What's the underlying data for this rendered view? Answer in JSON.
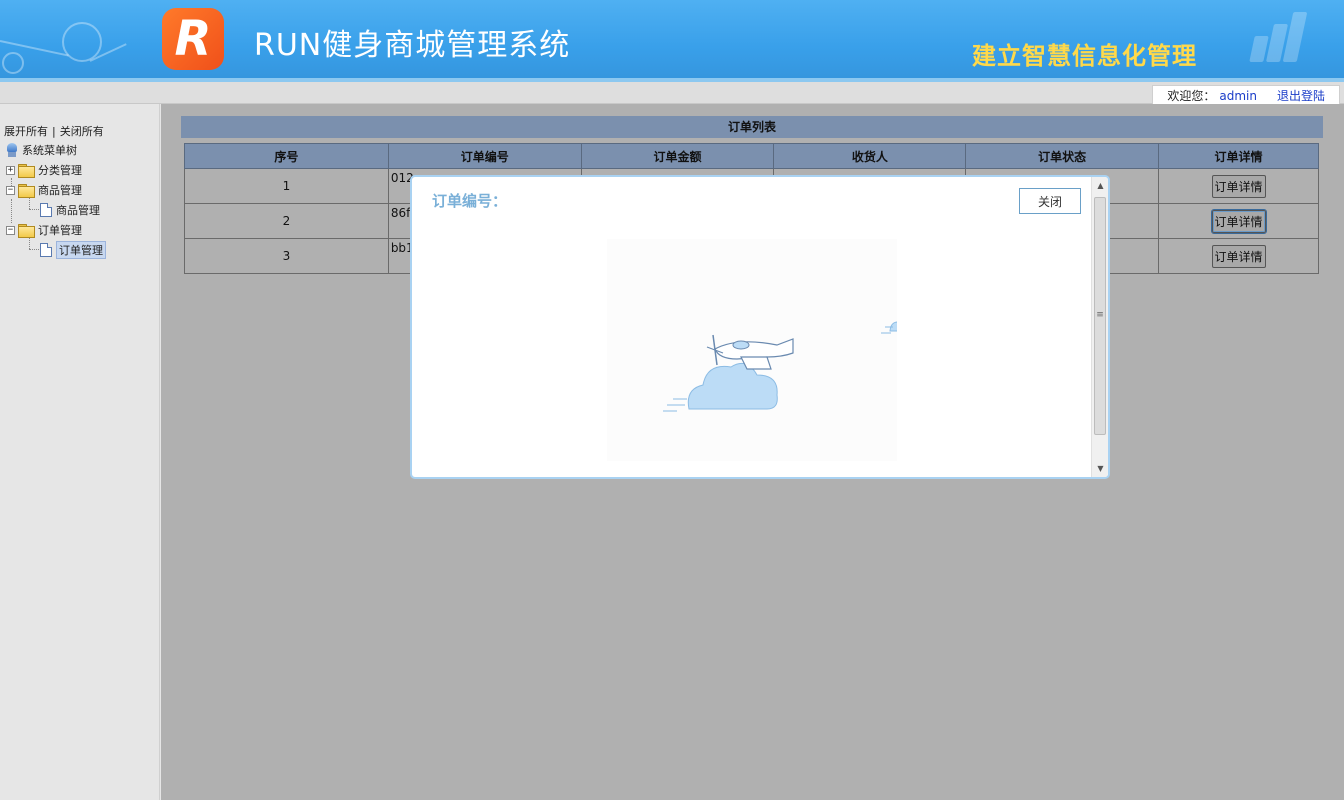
{
  "header": {
    "logo_letter": "R",
    "title": "RUN健身商城管理系统",
    "slogan": "建立智慧信息化管理",
    "brand_color": "#3aa0ea",
    "logo_color": "#f05a1a"
  },
  "topbar": {
    "welcome": "欢迎您：",
    "username": "admin",
    "logout": "退出登陆"
  },
  "sidebar": {
    "expand_all": "展开所有",
    "separator": "|",
    "collapse_all": "关闭所有",
    "root": "系统菜单树",
    "items": [
      {
        "label": "分类管理",
        "expander": "+"
      },
      {
        "label": "商品管理",
        "expander": "−"
      },
      {
        "label": "商品管理"
      },
      {
        "label": "订单管理",
        "expander": "−"
      },
      {
        "label": "订单管理"
      }
    ]
  },
  "main": {
    "panel_title": "订单列表",
    "columns": [
      "序号",
      "订单编号",
      "订单金额",
      "收货人",
      "订单状态",
      "订单详情"
    ],
    "rows": [
      {
        "index": "1",
        "order_no": "012",
        "amount": "",
        "receiver": "",
        "status": "",
        "action": "订单详情"
      },
      {
        "index": "2",
        "order_no": "86f",
        "amount": "",
        "receiver": "",
        "status": "",
        "action": "订单详情"
      },
      {
        "index": "3",
        "order_no": "bb1",
        "amount": "",
        "receiver": "",
        "status": "",
        "action": "订单详情"
      }
    ]
  },
  "modal": {
    "title": "订单编号：",
    "close": "关闭",
    "scroll_up": "▲",
    "scroll_down": "▼",
    "scroll_grip": "≡"
  }
}
